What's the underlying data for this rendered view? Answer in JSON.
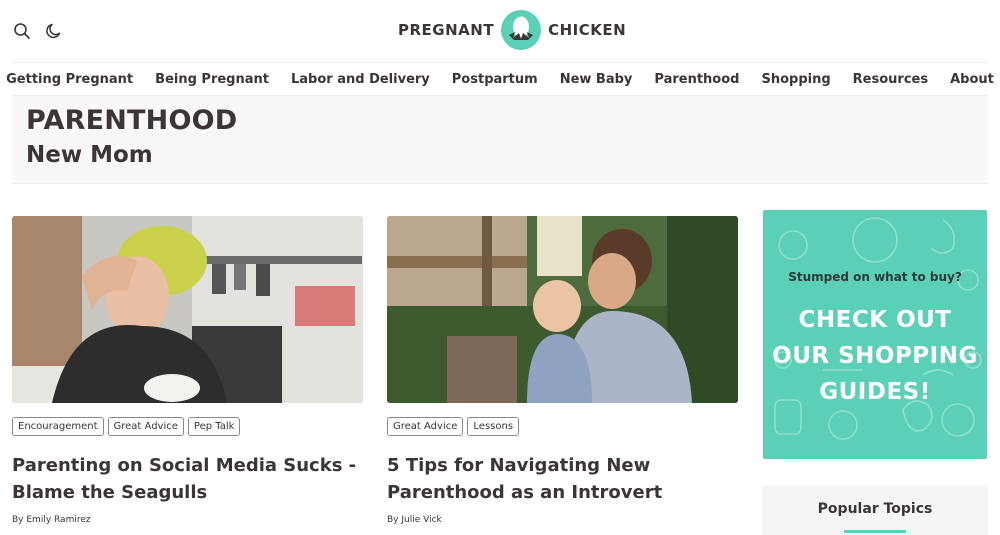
{
  "header": {
    "logo_left": "PREGNANT",
    "logo_right": "CHICKEN",
    "search_icon": "search-icon",
    "theme_icon": "moon-icon"
  },
  "nav": {
    "items": [
      {
        "label": "Getting Pregnant"
      },
      {
        "label": "Being Pregnant"
      },
      {
        "label": "Labor and Delivery"
      },
      {
        "label": "Postpartum"
      },
      {
        "label": "New Baby"
      },
      {
        "label": "Parenthood"
      },
      {
        "label": "Shopping"
      },
      {
        "label": "Resources"
      },
      {
        "label": "About"
      }
    ]
  },
  "banner": {
    "title": "PARENTHOOD",
    "subtitle": "New Mom"
  },
  "articles": [
    {
      "tags": [
        "Encouragement",
        "Great Advice",
        "Pep Talk"
      ],
      "title": "Parenting on Social Media Sucks - Blame the Seagulls",
      "byline": "By Emily Ramirez"
    },
    {
      "tags": [
        "Great Advice",
        "Lessons"
      ],
      "title": "5 Tips for Navigating New Parenthood as an Introvert",
      "byline": "By Julie Vick"
    }
  ],
  "ad": {
    "small": "Stumped on what to buy?",
    "big_line1": "CHECK OUT",
    "big_line2": "OUR SHOPPING",
    "big_line3": "GUIDES!"
  },
  "sidebar": {
    "popular_title": "Popular Topics"
  },
  "colors": {
    "brand_teal": "#5ccfb7",
    "text_dark": "#3d3535"
  }
}
